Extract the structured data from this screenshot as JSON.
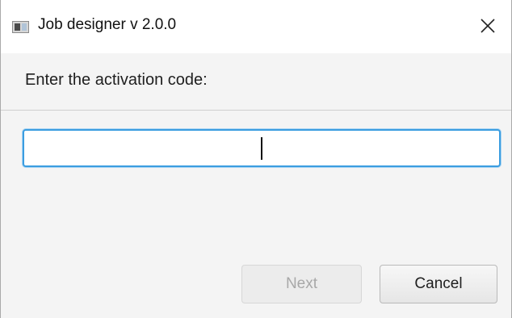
{
  "window": {
    "title": "Job designer v 2.0.0",
    "icon": "app-window-icon",
    "close_icon": "close-icon"
  },
  "dialog": {
    "header_text": "Enter the activation code:",
    "activation_code": {
      "value": "",
      "placeholder": ""
    },
    "buttons": {
      "next_label": "Next",
      "next_enabled": false,
      "cancel_label": "Cancel"
    }
  },
  "colors": {
    "focus_border": "#3b9de0",
    "disabled_text": "#a8a8a8"
  }
}
